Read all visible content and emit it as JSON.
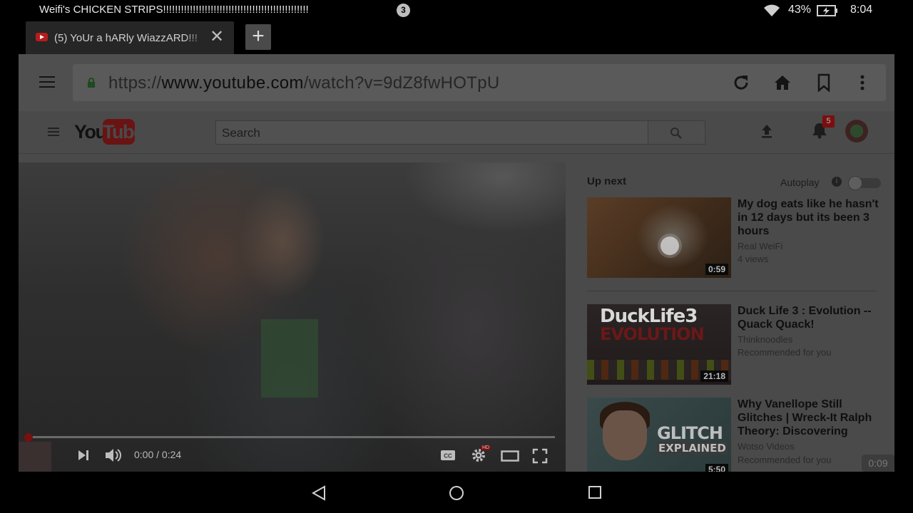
{
  "status_bar": {
    "notification_title": "Weifi's CHICKEN STRIPS!!!!!!!!!!!!!!!!!!!!!!!!!!!!!!!!!!!!!!!!!!!!!!!!!",
    "notification_count": "3",
    "battery_percent": "43%",
    "time": "8:04"
  },
  "browser": {
    "tab": {
      "title": "(5) YoUr a hARly WiazzARD!!!",
      "close_glyph": "✕"
    },
    "new_tab_glyph": "+",
    "url": {
      "protocol": "https://",
      "host": "www.youtube.com",
      "path": "/watch?v=9dZ8fwHOTpU"
    }
  },
  "youtube": {
    "logo_you": "You",
    "logo_tube": "Tube",
    "search_placeholder": "Search",
    "notification_count": "5",
    "player": {
      "time_display": "0:00 / 0:24",
      "progress": 0.0,
      "hd_badge": "HD"
    },
    "rail": {
      "up_next_label": "Up next",
      "autoplay_label": "Autoplay",
      "autoplay_on": false,
      "info_glyph": "i",
      "videos": [
        {
          "title": "My dog eats like he hasn't in 12 days but its been 3 hours",
          "channel": "Real WeiFi",
          "meta": "4 views",
          "duration": "0:59"
        },
        {
          "title": "Duck Life 3 : Evolution -- Quack Quack!",
          "channel": "Thinknoodles",
          "meta": "Recommended for you",
          "duration": "21:18",
          "thumb_text_1": "DuckLife3",
          "thumb_text_2": "EVOLUTION"
        },
        {
          "title": "Why Vanellope Still Glitches | Wreck-It Ralph Theory: Discovering",
          "channel": "Wotso Videos",
          "meta": "Recommended for you",
          "duration": "5:50",
          "thumb_text_1": "GLITCH",
          "thumb_text_2": "EXPLAINED"
        }
      ]
    }
  },
  "floating_timer": "0:09",
  "colors": {
    "youtube_red": "#7a0f0f",
    "dim_overlay_bg": "#4a4a4a"
  }
}
